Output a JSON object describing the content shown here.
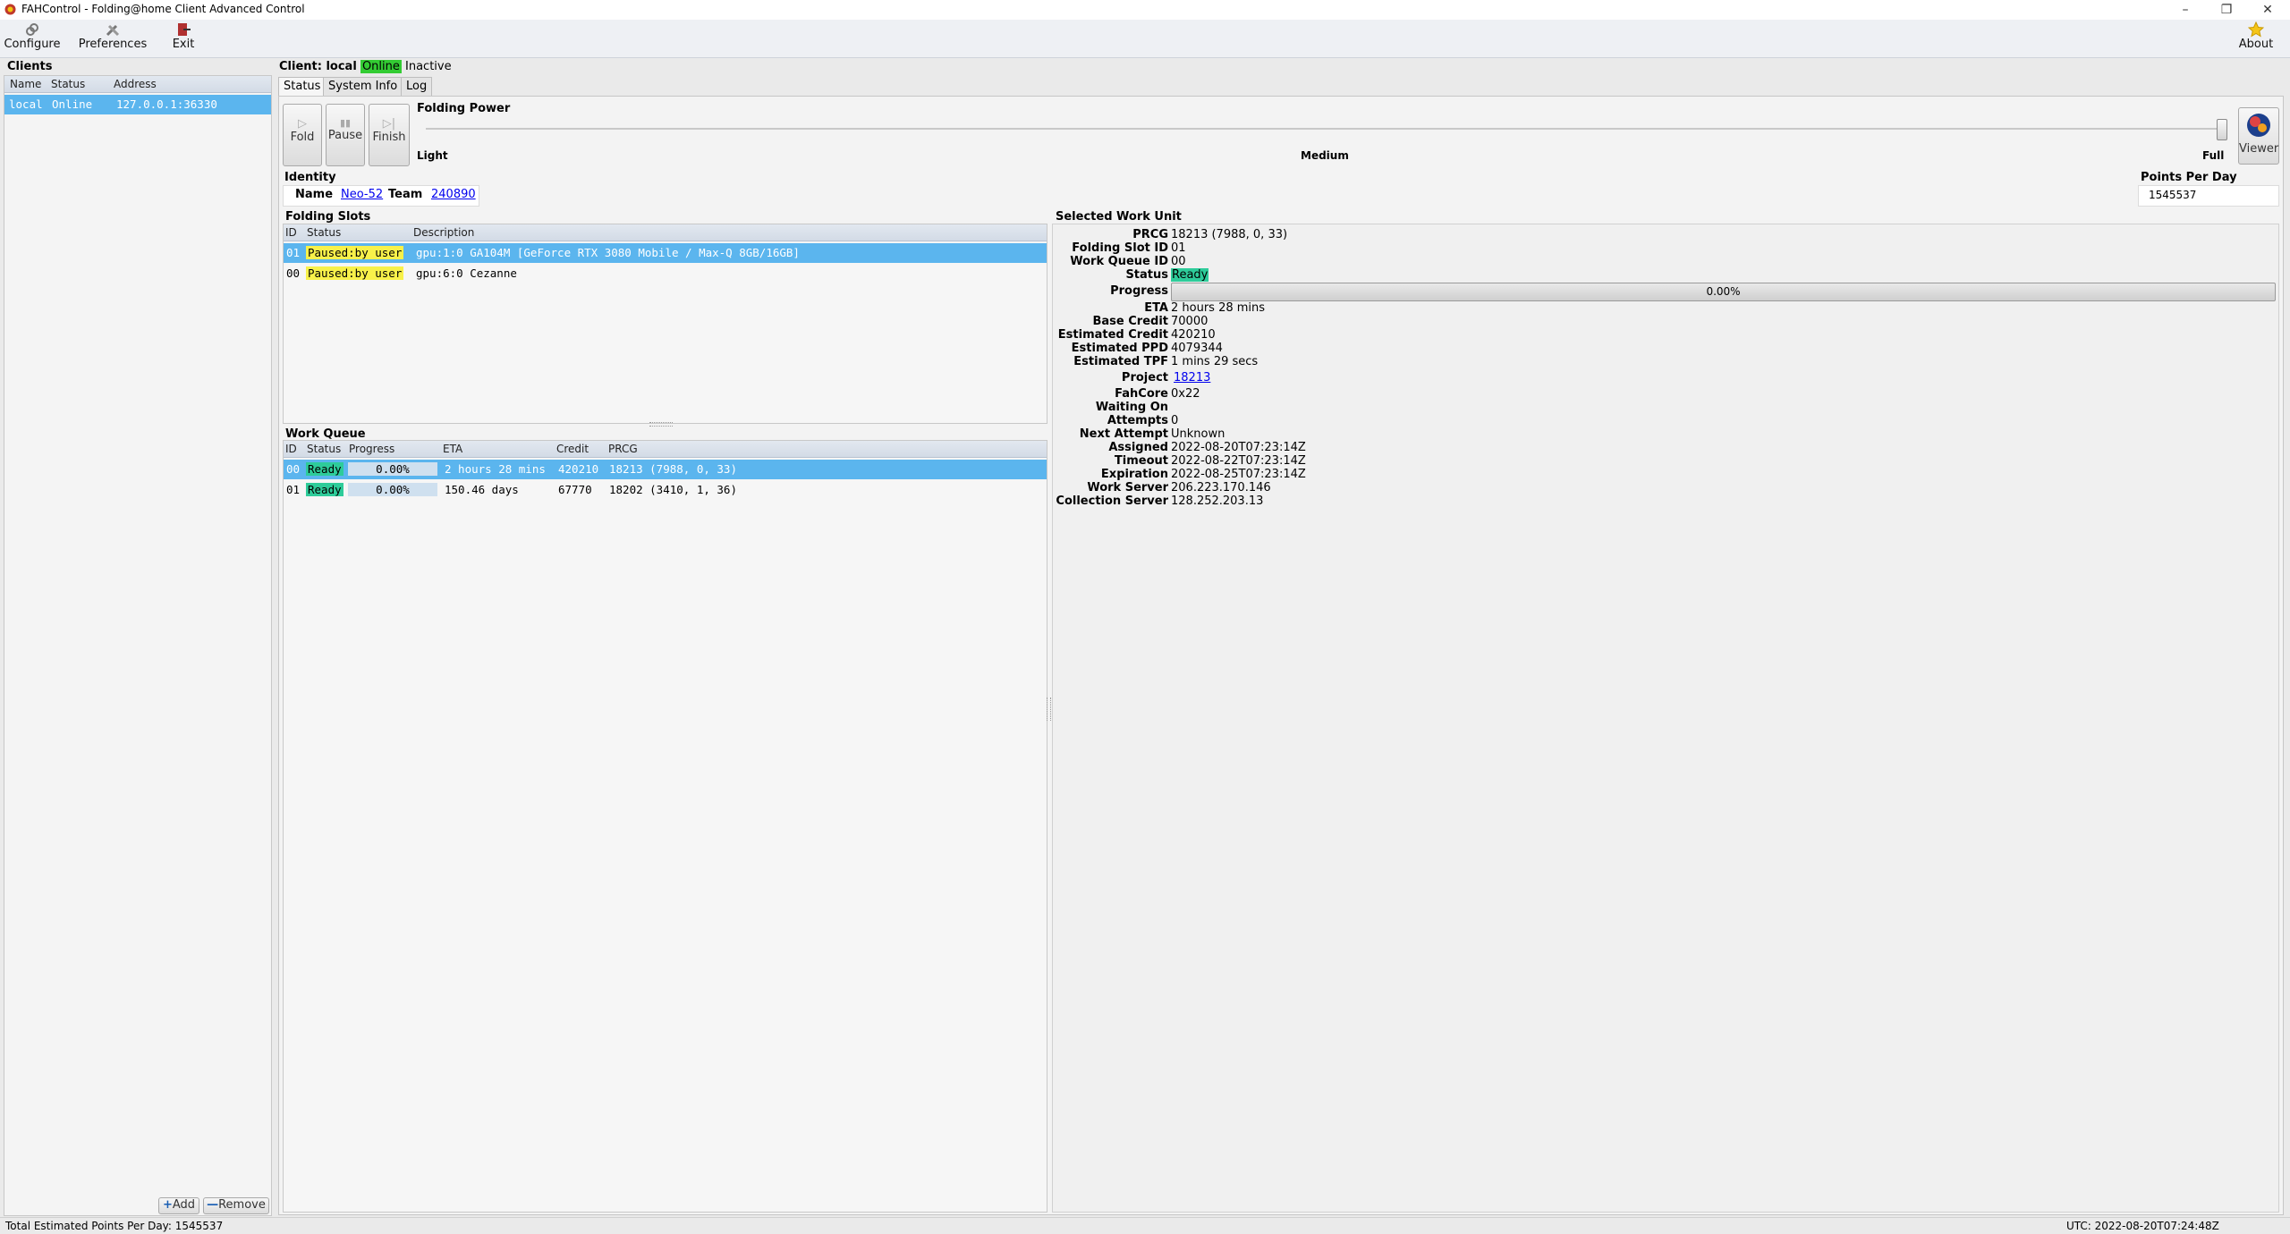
{
  "window": {
    "title": "FAHControl - Folding@home Client Advanced Control",
    "controls": [
      "–",
      "❐",
      "✕"
    ]
  },
  "toolbar": {
    "configure": "Configure",
    "preferences": "Preferences",
    "exit": "Exit",
    "about": "About"
  },
  "clients": {
    "title": "Clients",
    "headers": [
      "Name",
      "Status",
      "Address"
    ],
    "rows": [
      {
        "name": "local",
        "status": "Online",
        "address": "127.0.0.1:36330"
      }
    ],
    "add_label": "Add",
    "remove_label": "Remove"
  },
  "client_header": {
    "prefix": "Client: local",
    "online": "Online",
    "inactive": "Inactive"
  },
  "tabs": [
    "Status",
    "System Info",
    "Log"
  ],
  "folding_power": {
    "title": "Folding Power",
    "buttons": [
      "Fold",
      "Pause",
      "Finish"
    ],
    "labels": [
      "Light",
      "Medium",
      "Full"
    ],
    "level": 1.0,
    "viewer": "Viewer"
  },
  "identity": {
    "title": "Identity",
    "name_label": "Name",
    "name": "Neo-52",
    "team_label": "Team",
    "team": "240890"
  },
  "ppd": {
    "title": "Points Per Day",
    "value": "1545537"
  },
  "folding_slots": {
    "title": "Folding Slots",
    "headers": [
      "ID",
      "Status",
      "Description"
    ],
    "rows": [
      {
        "id": "01",
        "status": "Paused:by user",
        "description": "gpu:1:0 GA104M [GeForce RTX 3080 Mobile / Max-Q 8GB/16GB]"
      },
      {
        "id": "00",
        "status": "Paused:by user",
        "description": "gpu:6:0 Cezanne"
      }
    ]
  },
  "work_queue": {
    "title": "Work Queue",
    "headers": [
      "ID",
      "Status",
      "Progress",
      "ETA",
      "Credit",
      "PRCG"
    ],
    "rows": [
      {
        "id": "00",
        "status": "Ready",
        "progress": "0.00%",
        "eta": "2 hours 28 mins",
        "credit": "420210",
        "prcg": "18213 (7988, 0, 33)"
      },
      {
        "id": "01",
        "status": "Ready",
        "progress": "0.00%",
        "eta": "150.46 days",
        "credit": "67770",
        "prcg": "18202 (3410, 1, 36)"
      }
    ]
  },
  "selected_wu": {
    "title": "Selected Work Unit",
    "prcg_label": "PRCG",
    "prcg": "18213 (7988, 0, 33)",
    "slot_label": "Folding Slot ID",
    "slot": "01",
    "queue_label": "Work Queue ID",
    "queue": "00",
    "status_label": "Status",
    "status": "Ready",
    "progress_label": "Progress",
    "progress": "0.00%",
    "progress_fraction": 0.0,
    "eta_label": "ETA",
    "eta": "2 hours 28 mins",
    "base_credit_label": "Base Credit",
    "base_credit": "70000",
    "est_credit_label": "Estimated Credit",
    "est_credit": "420210",
    "est_ppd_label": "Estimated PPD",
    "est_ppd": "4079344",
    "est_tpf_label": "Estimated TPF",
    "est_tpf": "1 mins 29 secs",
    "project_label": "Project",
    "project": "18213",
    "fahcore_label": "FahCore",
    "fahcore": "0x22",
    "waiting_label": "Waiting On",
    "waiting": "",
    "attempts_label": "Attempts",
    "attempts": "0",
    "next_attempt_label": "Next Attempt",
    "next_attempt": "Unknown",
    "assigned_label": "Assigned",
    "assigned": "2022-08-20T07:23:14Z",
    "timeout_label": "Timeout",
    "timeout": "2022-08-22T07:23:14Z",
    "expiration_label": "Expiration",
    "expiration": "2022-08-25T07:23:14Z",
    "work_server_label": "Work Server",
    "work_server": "206.223.170.146",
    "collection_server_label": "Collection Server",
    "collection_server": "128.252.203.13"
  },
  "statusbar": {
    "left": "Total Estimated Points Per Day: 1545537",
    "right": "UTC: 2022-08-20T07:24:48Z"
  },
  "colors": {
    "selection": "#5bb5ee",
    "ready": "#2ecc9a",
    "paused": "#f8f14a",
    "online": "#33cc33"
  }
}
